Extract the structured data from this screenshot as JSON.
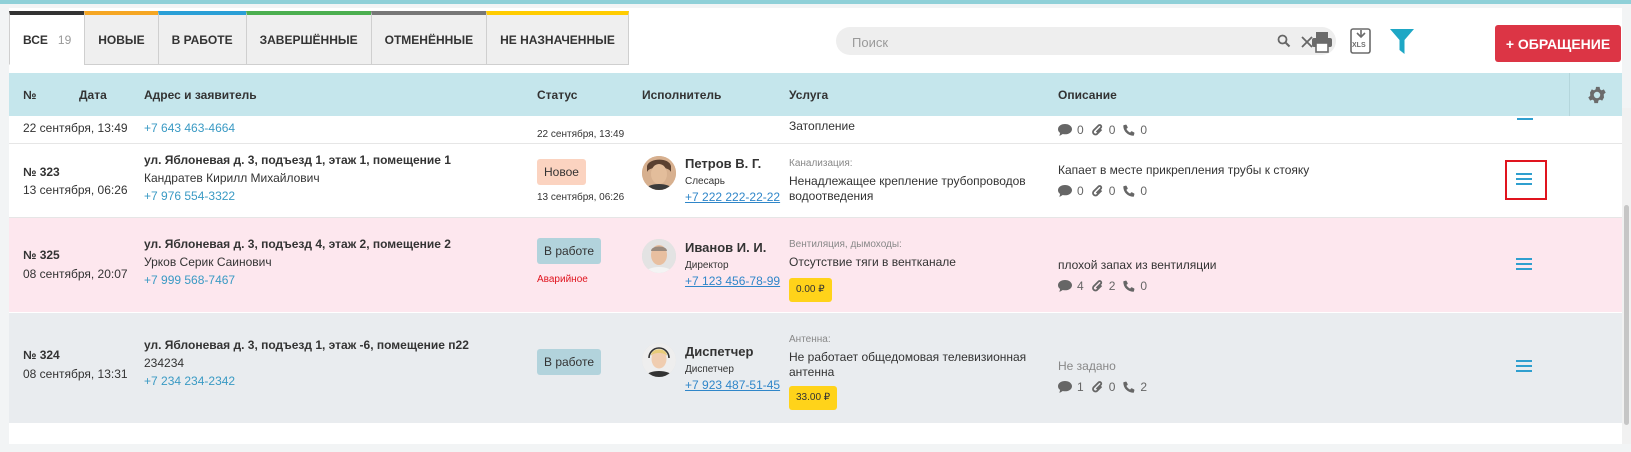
{
  "tabs": [
    {
      "label": "ВСЕ",
      "count": "19",
      "color": "#333333"
    },
    {
      "label": "НОВЫЕ",
      "color": "#f5a623"
    },
    {
      "label": "В РАБОТЕ",
      "color": "#2a9fd6"
    },
    {
      "label": "ЗАВЕРШЁННЫЕ",
      "color": "#4caf50"
    },
    {
      "label": "ОТМЕНЁННЫЕ",
      "color": "#777777"
    },
    {
      "label": "НЕ НАЗНАЧЕННЫЕ",
      "color": "#ffcc00"
    }
  ],
  "search": {
    "placeholder": "Поиск"
  },
  "toolbar": {
    "new_label": "+ ОБРАЩЕНИЕ",
    "xls_label": "XLS",
    "accent": "#dc3545",
    "filter_color": "#1ea7c5"
  },
  "columns": {
    "num": "№",
    "date": "Дата",
    "address": "Адрес и заявитель",
    "status": "Статус",
    "executor": "Исполнитель",
    "service": "Услуга",
    "description": "Описание"
  },
  "partial_row": {
    "date": "22 сентября",
    "time": ", 13:49",
    "phone": "+7 643 463-4664",
    "status_date": "22 сентября, 13:49",
    "service": "Затопление",
    "comments": "0",
    "files": "0",
    "calls": "0"
  },
  "rows": [
    {
      "num": "№ 323",
      "date": "13 сентября",
      "time": ", 06:26",
      "address": "ул. Яблоневая д. 3, подъезд 1, этаж 1, помещение 1",
      "applicant": "Кандратев Кирилл Михайлович",
      "phone": "+7 976 554-3322",
      "status": "Новое",
      "status_sub": "13 сентября, 06:26",
      "exec_name": "Петров В. Г.",
      "exec_role": "Слесарь",
      "exec_phone": "+7 222 222-22-22",
      "service_cat": "Канализация:",
      "service_line1": "Ненадлежащее крепление трубопроводов",
      "service_line2": "водоотведения",
      "description": "Капает в месте прикрепления трубы к стояку",
      "comments": "0",
      "files": "0",
      "calls": "0"
    },
    {
      "num": "№ 325",
      "date": "08 сентября",
      "time": ", 20:07",
      "address": "ул. Яблоневая д. 3, подъезд 4, этаж 2, помещение 2",
      "applicant": "Урков Серик Саинович",
      "phone": "+7 999 568-7467",
      "status": "В работе",
      "status_sub": "Аварийное",
      "exec_name": "Иванов И. И.",
      "exec_role": "Директор",
      "exec_phone": "+7 123 456-78-99",
      "service_cat": "Вентиляция, дымоходы:",
      "service_line1": "Отсутствие тяги в вентканале",
      "price": "0.00 ₽",
      "description": "плохой запах из вентиляции",
      "comments": "4",
      "files": "2",
      "calls": "0"
    },
    {
      "num": "№ 324",
      "date": "08 сентября",
      "time": ", 13:31",
      "address": "ул. Яблоневая д. 3, подъезд 1, этаж -6, помещение п22",
      "applicant": "234234",
      "phone": "+7 234 234-2342",
      "status": "В работе",
      "exec_name": "Диспетчер",
      "exec_role": "Диспетчер",
      "exec_phone": "+7 923 487-51-45",
      "service_cat": "Антенна:",
      "service_line1": "Не работает общедомовая телевизионная",
      "service_line2": "антенна",
      "price": "33.00 ₽",
      "description": "Не задано",
      "comments": "1",
      "files": "0",
      "calls": "2"
    }
  ]
}
